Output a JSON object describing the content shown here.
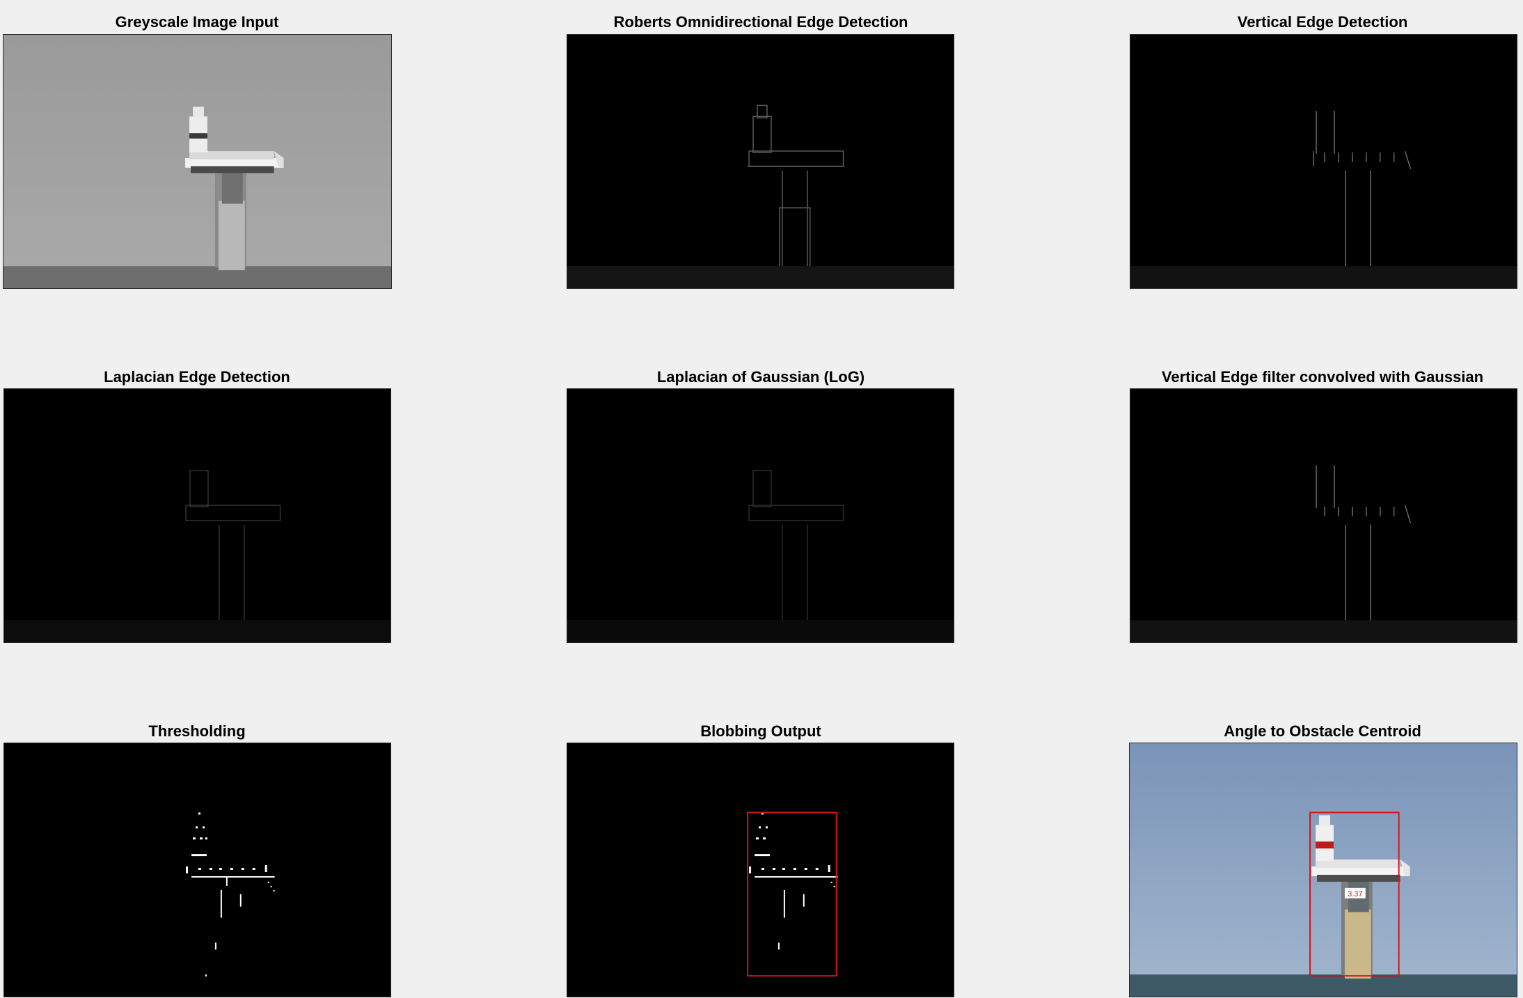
{
  "figure": {
    "panels": [
      {
        "title": "Greyscale Image Input",
        "kind": "grey"
      },
      {
        "title": "Roberts Omnidirectional Edge Detection",
        "kind": "edge"
      },
      {
        "title": "Vertical Edge Detection",
        "kind": "vedge"
      },
      {
        "title": "Laplacian Edge Detection",
        "kind": "edge-dim"
      },
      {
        "title": "Laplacian of Gaussian (LoG)",
        "kind": "edge-dim"
      },
      {
        "title": "Vertical Edge filter convolved with Gaussian",
        "kind": "vedge"
      },
      {
        "title": "Thresholding",
        "kind": "thresh"
      },
      {
        "title": "Blobbing Output",
        "kind": "blob"
      },
      {
        "title": "Angle to Obstacle Centroid",
        "kind": "color"
      }
    ],
    "angle_label": "3.37",
    "colors": {
      "background": "#f0f0f0",
      "bounding_box": "#d21414",
      "sky": "#8aa3c2",
      "sea": "#3d5a66"
    }
  }
}
